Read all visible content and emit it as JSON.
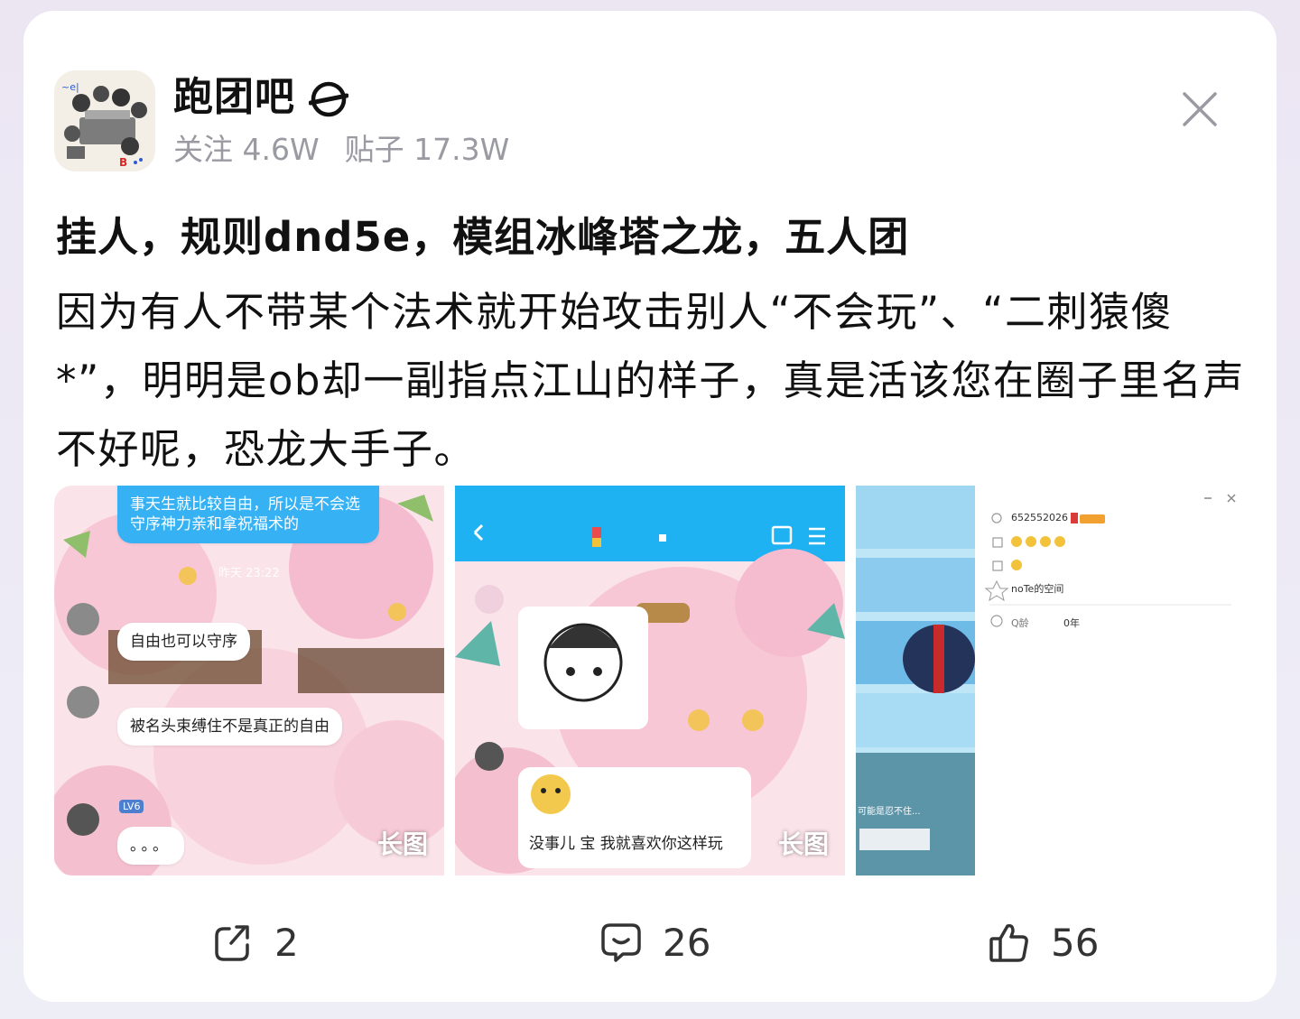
{
  "forum": {
    "name": "跑团吧",
    "follow_label": "关注",
    "follow_count": "4.6W",
    "posts_label": "贴子",
    "posts_count": "17.3W"
  },
  "post": {
    "title": "挂人，规则dnd5e，模组冰峰塔之龙，五人团",
    "content": "因为有人不带某个法术就开始攻击别人“不会玩”、“二刺猿傻*”，明明是ob却一副指点江山的样子，真是活该您在圈子里名声不好呢，恐龙大手子。"
  },
  "images": [
    {
      "long_tag": "长图",
      "bubbles": [
        "事天生就比较自由，所以是不会选守序神力亲和拿祝福术的",
        "自由也可以守序",
        "被名头束缚住不是真正的自由",
        "。。。"
      ],
      "time": "昨天 23:22",
      "level": "LV6"
    },
    {
      "long_tag": "长图",
      "bubbles": [
        "没事儿 宝 我就喜欢你这样玩"
      ]
    },
    {
      "qq_number": "652552026",
      "space_label": "noTe的空间",
      "age_label": "Q龄",
      "age_value": "0年",
      "signature": "可能是忍不住..."
    }
  ],
  "actions": {
    "share_count": "2",
    "comment_count": "26",
    "like_count": "56"
  }
}
